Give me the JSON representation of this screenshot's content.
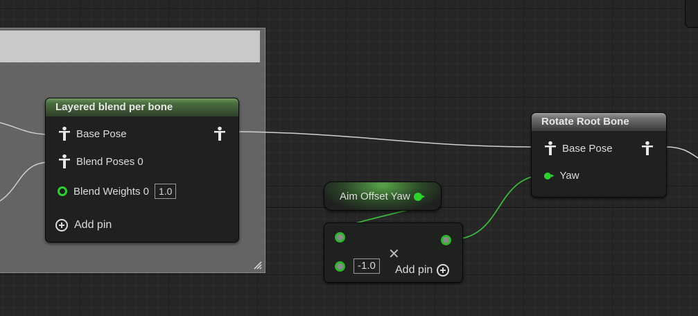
{
  "nodes": {
    "layered_blend": {
      "title": "Layered blend per bone",
      "pins": {
        "base_pose": "Base Pose",
        "blend_poses": "Blend Poses 0",
        "blend_weights": "Blend Weights 0",
        "blend_weights_value": "1.0",
        "add_pin": "Add pin"
      }
    },
    "rotate_root_bone": {
      "title": "Rotate Root Bone",
      "pins": {
        "base_pose": "Base Pose",
        "yaw": "Yaw"
      }
    },
    "aim_offset_yaw": {
      "label": "Aim Offset Yaw"
    },
    "multiply": {
      "operator_icon": "multiply-icon",
      "operator_glyph": "✕",
      "value": "-1.0",
      "add_pin": "Add pin"
    }
  },
  "colors": {
    "float_pin": "#2fd12f",
    "wire_pose": "#d0d0d0",
    "wire_float": "#3cb83c",
    "canvas_bg": "#262626",
    "node_body": "#1f211f",
    "comment_bg": "#767676"
  }
}
